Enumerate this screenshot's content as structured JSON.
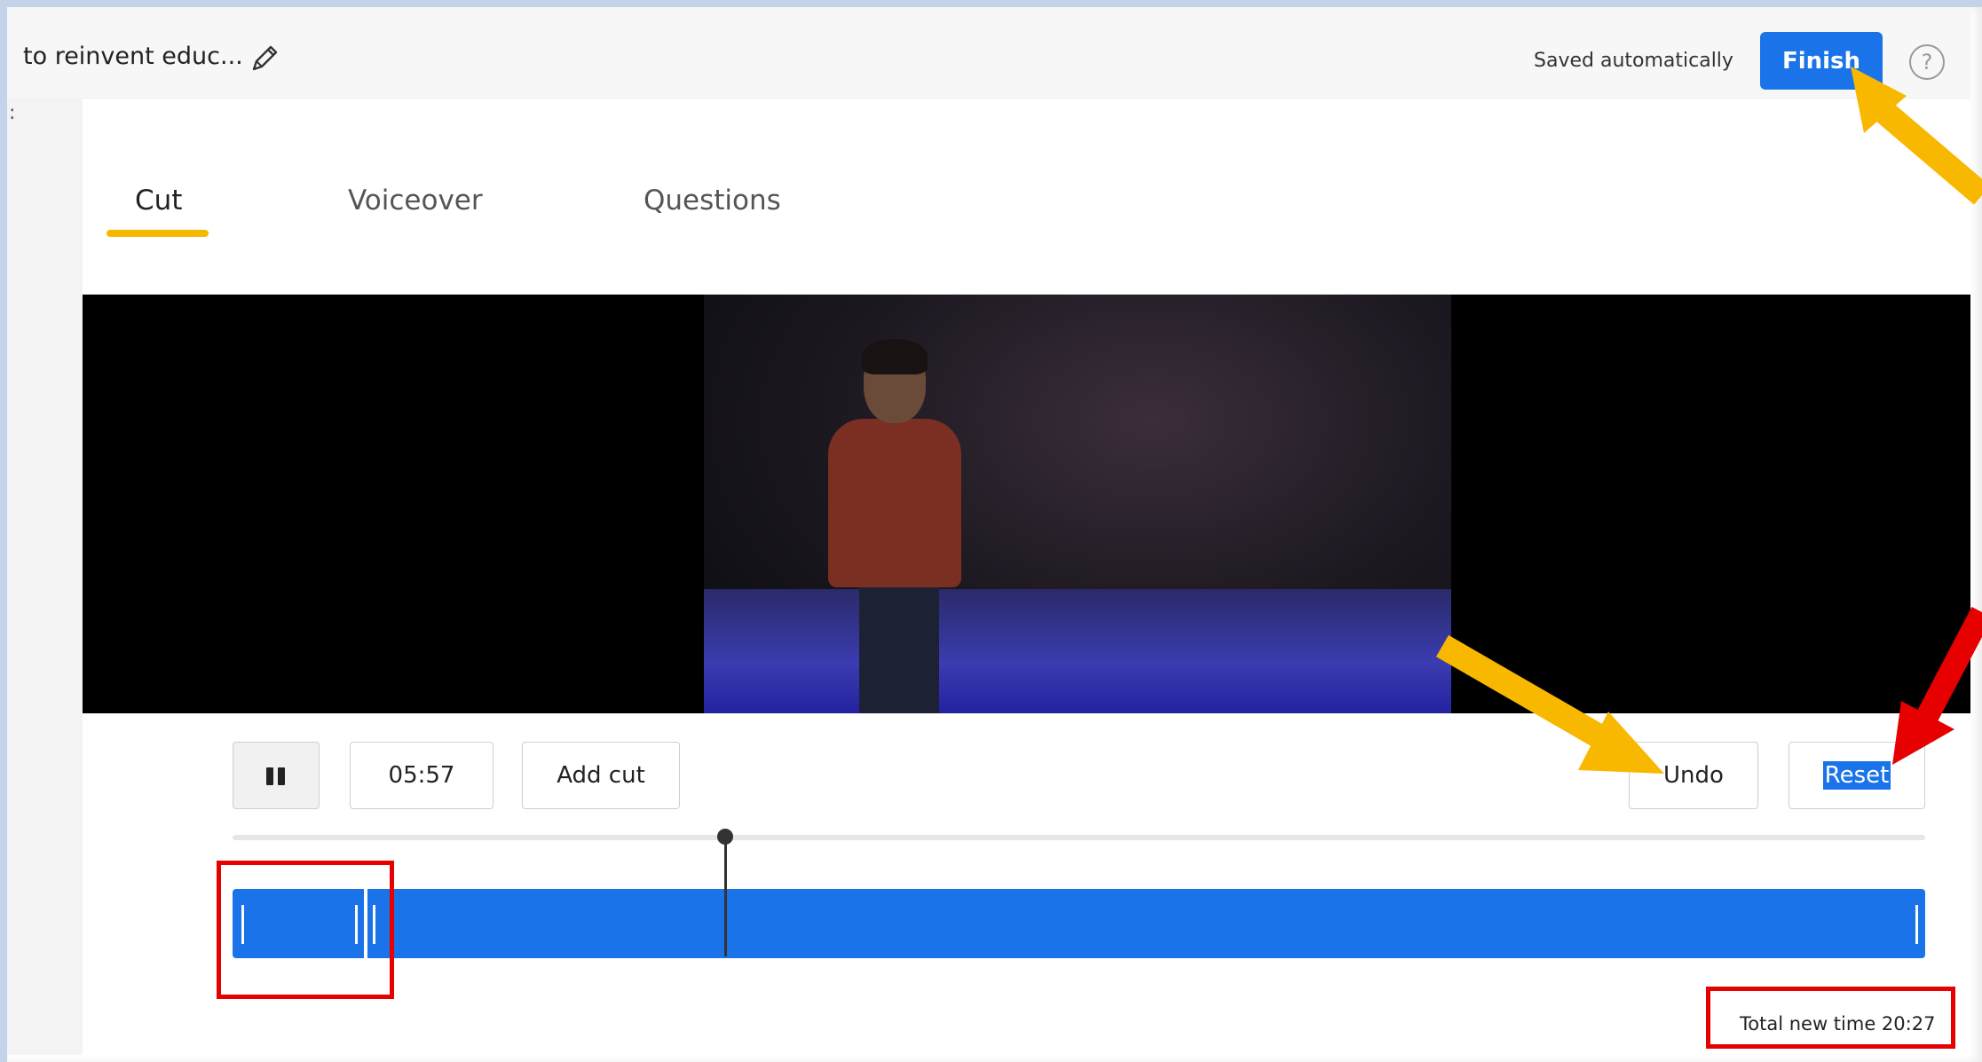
{
  "header": {
    "title": "to reinvent educ...",
    "saved_status": "Saved automatically",
    "finish_label": "Finish",
    "help_symbol": "?"
  },
  "sidebar": {
    "mark": ":"
  },
  "tabs": [
    {
      "label": "Cut",
      "active": true
    },
    {
      "label": "Voiceover",
      "active": false
    },
    {
      "label": "Questions",
      "active": false
    }
  ],
  "controls": {
    "current_time": "05:57",
    "add_cut_label": "Add cut",
    "undo_label": "Undo",
    "reset_label": "Reset"
  },
  "timeline": {
    "total_new_time": "Total new time 20:27"
  },
  "colors": {
    "accent": "#1a73e8",
    "tab_underline": "#f5b800",
    "annotation_red": "#e60000",
    "annotation_yellow": "#f9b800"
  },
  "icons": [
    "pencil-icon",
    "help-icon",
    "pause-icon"
  ]
}
